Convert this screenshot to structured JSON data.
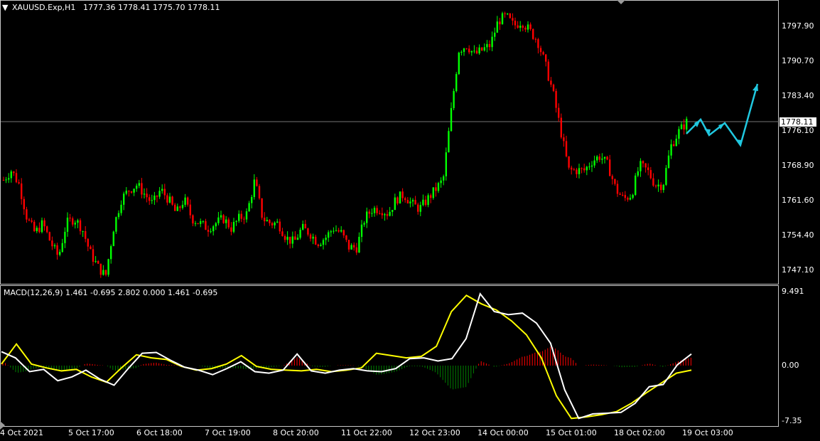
{
  "header": {
    "symbol_label": "XAUUSD.Exp,H1",
    "ohlc": "1777.36 1778.41 1775.70 1778.11",
    "indicator_label": "MACD(12,26,9) 1.461 -0.695 2.802 0.000 1.461 -0.695"
  },
  "current_price": "1778.11",
  "price_axis": [
    "1797.90",
    "1790.70",
    "1783.40",
    "1776.10",
    "1768.90",
    "1761.60",
    "1754.40",
    "1747.10"
  ],
  "macd_axis": [
    "9.491",
    "0.00",
    "-7.35"
  ],
  "time_axis": [
    "4 Oct 2021",
    "5 Oct 17:00",
    "6 Oct 18:00",
    "7 Oct 19:00",
    "8 Oct 20:00",
    "11 Oct 22:00",
    "12 Oct 23:00",
    "14 Oct 00:00",
    "15 Oct 01:00",
    "18 Oct 02:00",
    "19 Oct 03:00"
  ],
  "colors": {
    "bull": "#00ff00",
    "bear": "#ff0000",
    "macd_line": "#ffffff",
    "signal_line": "#ffff00",
    "hist_pos": "#ff0000",
    "hist_neg": "#008000",
    "projection": "#20c8e0"
  },
  "chart_data": [
    {
      "type": "candlestick",
      "title": "XAUUSD.Exp,H1",
      "ylim": [
        1744.5,
        1802.5
      ],
      "close_path": [
        1766,
        1768,
        1765,
        1758,
        1755,
        1757,
        1753,
        1750,
        1757,
        1758,
        1756,
        1751,
        1748,
        1746,
        1756,
        1762,
        1764,
        1765,
        1763,
        1761,
        1764,
        1762,
        1759,
        1762,
        1758,
        1757,
        1756,
        1757,
        1758,
        1756,
        1758,
        1759,
        1766,
        1758,
        1757,
        1757,
        1754,
        1753,
        1756,
        1755,
        1753,
        1754,
        1756,
        1755,
        1752,
        1752,
        1758,
        1760,
        1760,
        1759,
        1762,
        1763,
        1761,
        1760,
        1762,
        1764,
        1766,
        1780,
        1793,
        1794,
        1792,
        1793,
        1794,
        1799,
        1800,
        1798,
        1799,
        1797,
        1795,
        1790,
        1784,
        1776,
        1768,
        1768,
        1768,
        1770,
        1771,
        1769,
        1764,
        1762,
        1763,
        1769,
        1768,
        1765,
        1765,
        1773,
        1776,
        1778
      ]
    },
    {
      "type": "line",
      "title": "MACD(12,26,9)",
      "ylim": [
        -7.35,
        9.491
      ],
      "series": [
        {
          "name": "MACD",
          "values": [
            1.8,
            1.0,
            -0.8,
            -0.5,
            -2.0,
            -1.5,
            -0.6,
            -1.8,
            -2.6,
            -0.4,
            1.6,
            1.7,
            0.7,
            -0.2,
            -0.6,
            -1.2,
            -0.4,
            0.5,
            -0.8,
            -1.0,
            -0.6,
            1.5,
            -0.7,
            -1.0,
            -0.6,
            -0.4,
            -0.7,
            -0.8,
            -0.4,
            0.9,
            1.0,
            0.6,
            0.9,
            3.5,
            9.3,
            7.0,
            6.6,
            6.8,
            5.5,
            2.9,
            -3.2,
            -7.0,
            -6.4,
            -6.3,
            -6.2,
            -5.0,
            -2.8,
            -2.5,
            0.1,
            1.5
          ]
        },
        {
          "name": "Signal",
          "values": [
            0.2,
            2.8,
            0.2,
            -0.3,
            -0.7,
            -0.5,
            -1.5,
            -2.2,
            -0.3,
            1.4,
            1.0,
            0.8,
            -0.1,
            -0.6,
            -0.4,
            0.2,
            1.3,
            -0.1,
            -0.5,
            -0.6,
            -0.7,
            -0.5,
            -0.8,
            -0.6,
            -0.3,
            1.6,
            1.3,
            1.0,
            1.2,
            2.5,
            7.0,
            9.1,
            8.0,
            7.2,
            5.8,
            4.0,
            1.0,
            -4.0,
            -7.0,
            -6.8,
            -6.5,
            -6.1,
            -5.0,
            -3.6,
            -2.3,
            -1.0,
            -0.6
          ]
        }
      ]
    }
  ]
}
